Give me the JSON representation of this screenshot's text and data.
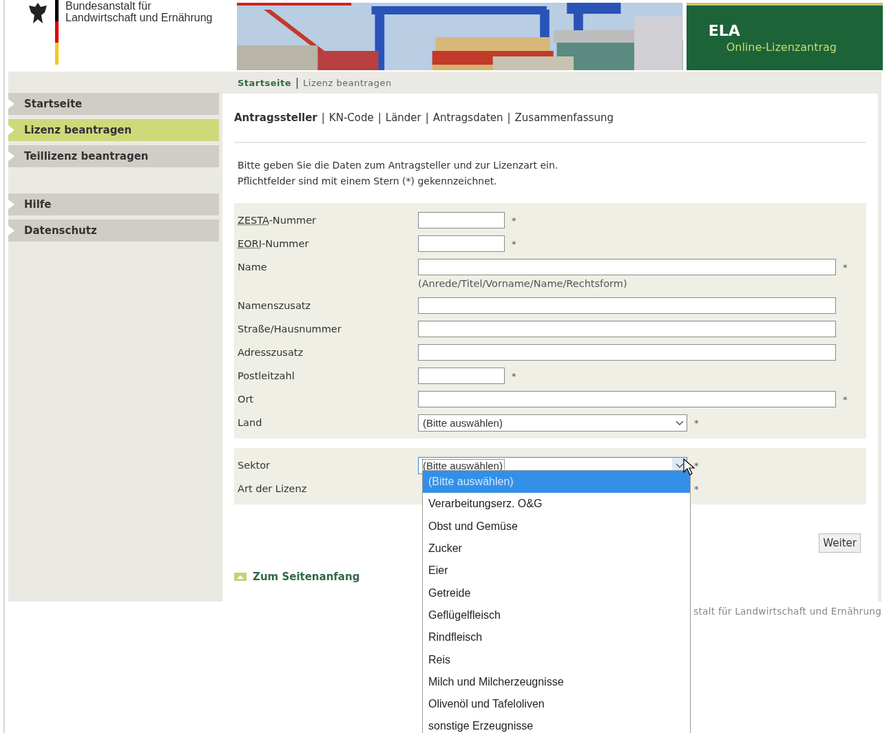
{
  "header": {
    "agency_lines": [
      "Bundesanstalt für",
      "Landwirtschaft und Ernährung"
    ],
    "app_title": "ELA",
    "app_subtitle": "Online-Lizenzantrag",
    "banner": {
      "kind": "picture"
    }
  },
  "separator": "|",
  "breadcrumb": [
    {
      "label": "Startseite",
      "selected": false
    },
    {
      "label": "Lizenz beantragen",
      "selected": true
    }
  ],
  "sidebar": {
    "groups": [
      [
        {
          "label": "Startseite",
          "selected": false
        },
        {
          "label": "Lizenz beantragen",
          "selected": true
        },
        {
          "label": "Teillizenz beantragen",
          "selected": false
        }
      ],
      [
        {
          "label": "Hilfe",
          "selected": false
        },
        {
          "label": "Datenschutz",
          "selected": false
        }
      ]
    ]
  },
  "steps": [
    {
      "label": "Antragssteller",
      "selected": true
    },
    {
      "label": "KN-Code",
      "selected": false
    },
    {
      "label": "Länder",
      "selected": false
    },
    {
      "label": "Antragsdaten",
      "selected": false
    },
    {
      "label": "Zusammenfassung",
      "selected": false
    }
  ],
  "intro": [
    "Bitte geben Sie die Daten zum Antragsteller und zur Lizenzart ein.",
    "Pflichtfelder sind mit einem Stern (*) gekennzeichnet."
  ],
  "sections": [
    [
      {
        "kind": "shortinput",
        "abbr": "ZESTA",
        "label": "-Nummer",
        "mark": "*"
      },
      {
        "kind": "shortinput",
        "abbr": "EORI",
        "label": "-Nummer",
        "mark": "*"
      },
      {
        "kind": "longinput",
        "label": "Name",
        "mark": "*"
      },
      {
        "kind": "hint",
        "text": "(Anrede/Titel/Vorname/Name/Rechtsform)"
      },
      {
        "kind": "longinput",
        "label": "Namenszusatz"
      },
      {
        "kind": "longinput",
        "label": "Straße/Hausnummer"
      },
      {
        "kind": "longinput",
        "label": "Adresszusatz"
      },
      {
        "kind": "shortinput",
        "label": "Postleitzahl",
        "mark": "*"
      },
      {
        "kind": "longinput",
        "label": "Ort",
        "mark": "*"
      },
      {
        "kind": "select",
        "label": "Land",
        "value": "(Bitte auswählen)",
        "mark": "*",
        "focused": false
      }
    ],
    [
      {
        "kind": "select",
        "label": "Sektor",
        "value": "(Bitte auswählen)",
        "mark": "*",
        "focused": true
      },
      {
        "kind": "covered",
        "label": "Art der Lizenz",
        "mark": "*"
      }
    ]
  ],
  "dropdown": [
    {
      "label": "(Bitte auswählen)",
      "selected": true
    },
    {
      "label": "Verarbeitungserz. O&G",
      "selected": false
    },
    {
      "label": "Obst und Gemüse",
      "selected": false
    },
    {
      "label": "Zucker",
      "selected": false
    },
    {
      "label": "Eier",
      "selected": false
    },
    {
      "label": "Getreide",
      "selected": false
    },
    {
      "label": "Geflügelfleisch",
      "selected": false
    },
    {
      "label": "Rindfleisch",
      "selected": false
    },
    {
      "label": "Reis",
      "selected": false
    },
    {
      "label": "Milch und Milcherzeugnisse",
      "selected": false
    },
    {
      "label": "Olivenöl und Tafeloliven",
      "selected": false
    },
    {
      "label": "sonstige Erzeugnisse",
      "selected": false
    }
  ],
  "next_button": "Weiter",
  "top_link": "Zum Seitenanfang",
  "footer": "stalt für Landwirtschaft und Ernährung"
}
